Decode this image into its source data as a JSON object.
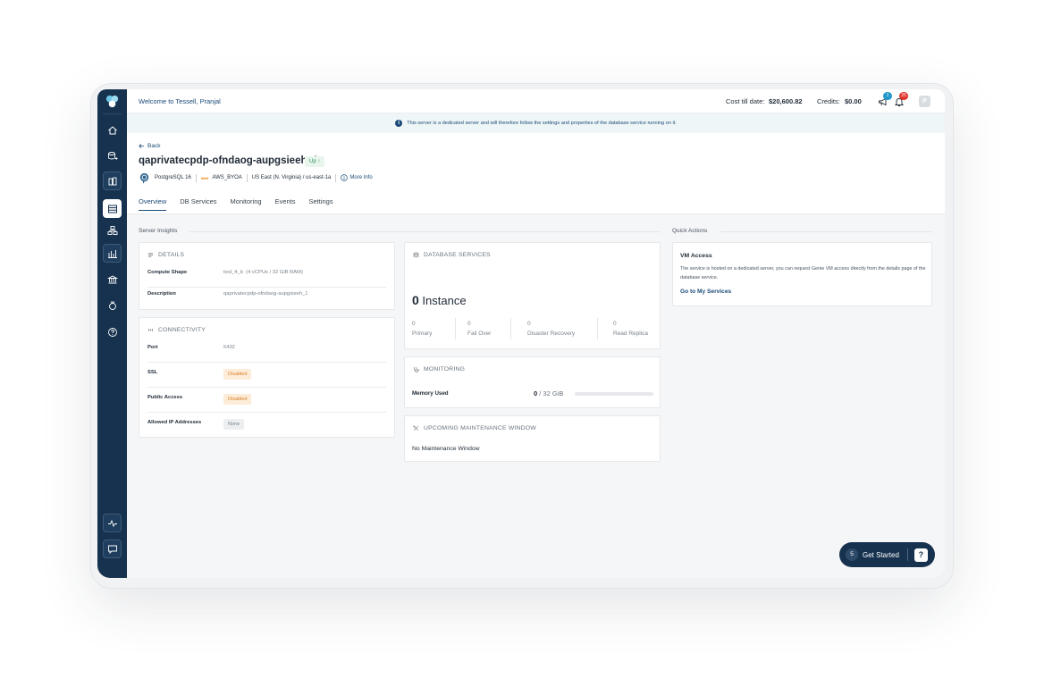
{
  "topbar": {
    "welcome": "Welcome to Tessell, Pranjal",
    "cost_label": "Cost till date:",
    "cost_value": "$20,600.82",
    "credits_label": "Credits:",
    "credits_value": "$0.00",
    "announcements_badge": "1",
    "notifications_badge": "25",
    "avatar_initial": "P"
  },
  "banner": {
    "text": "This server is a dedicated server and will therefore follow the settings and properties of the database service running on it."
  },
  "header": {
    "back_label": "Back",
    "server_name": "qaprivatecpdp-ofndaog-aupgsieeh_1",
    "status": "Up",
    "engine": "PostgreSQL 16",
    "cloud_logo": "aws",
    "cloud": "AWS_BYOA",
    "region": "US East (N. Virginia) / us-east-1a",
    "more_info": "More Info"
  },
  "tabs": [
    {
      "label": "Overview",
      "active": true
    },
    {
      "label": "DB Services"
    },
    {
      "label": "Monitoring"
    },
    {
      "label": "Events"
    },
    {
      "label": "Settings"
    }
  ],
  "sections": {
    "server_insights": "Server Insights",
    "quick_actions": "Quick Actions"
  },
  "details": {
    "title": "DETAILS",
    "compute_shape_label": "Compute Shape",
    "compute_shape_value": "tesl_4_b",
    "compute_shape_spec": "(4 vCPUs / 32 GiB RAM)",
    "description_label": "Description",
    "description_value": "qaprivatecpdp-ofndaog-aupgsieeh_1"
  },
  "connectivity": {
    "title": "CONNECTIVITY",
    "port_label": "Port",
    "port_value": "5432",
    "ssl_label": "SSL",
    "ssl_value": "Disabled",
    "public_access_label": "Public Access",
    "public_access_value": "Disabled",
    "allowed_ip_label": "Allowed IP Addresses",
    "allowed_ip_value": "None"
  },
  "db_services": {
    "title": "DATABASE SERVICES",
    "instance_count": "0",
    "instance_label": "Instance",
    "stats": [
      {
        "value": "0",
        "label": "Primary"
      },
      {
        "value": "0",
        "label": "Fail Over"
      },
      {
        "value": "0",
        "label": "Disaster Recovery"
      },
      {
        "value": "0",
        "label": "Read Replica"
      }
    ]
  },
  "monitoring": {
    "title": "MONITORING",
    "memory_label": "Memory Used",
    "memory_used": "0",
    "memory_total": "/ 32 GiB",
    "memory_fraction": 0
  },
  "maintenance": {
    "title": "UPCOMING MAINTENANCE WINDOW",
    "text": "No Maintenance Window"
  },
  "quick_actions": {
    "vm_title": "VM Access",
    "vm_desc": "The service is hosted on a dedicated server, you can request Genie VM access directly from the details page of the database service.",
    "vm_link": "Go to My Services"
  },
  "get_started": {
    "count": "5",
    "label": "Get Started"
  },
  "colors": {
    "sidebar": "#17324f",
    "accent": "#1c4b78",
    "status_up": "#2e8b57",
    "warning": "#d9822b"
  }
}
